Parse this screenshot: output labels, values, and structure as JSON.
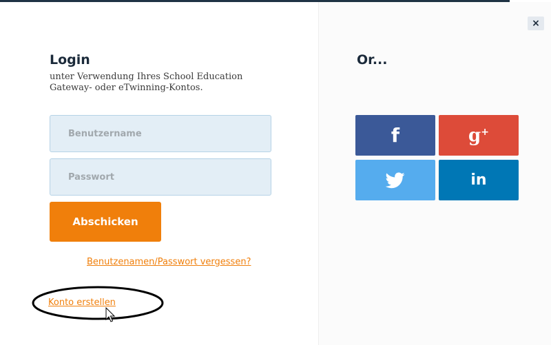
{
  "dialog": {
    "close_label": "×",
    "login": {
      "title": "Login",
      "subtitle": "unter Verwendung Ihres School Education Gateway- oder eTwinning-Kontos.",
      "username_placeholder": "Benutzername",
      "password_placeholder": "Passwort",
      "submit_label": "Abschicken",
      "forgot_label": "Benutzenamen/Passwort vergessen?",
      "create_label": "Konto erstellen"
    },
    "social": {
      "title": "Or...",
      "facebook_glyph": "f",
      "google_glyph": "g",
      "google_plus": "+",
      "linkedin_glyph": "in",
      "icons": [
        "facebook-icon",
        "google-plus-icon",
        "twitter-icon",
        "linkedin-icon"
      ]
    }
  },
  "colors": {
    "accent": "#f07f0b",
    "facebook": "#3b5998",
    "google": "#dd4b39",
    "twitter": "#55acee",
    "linkedin": "#0077b5"
  }
}
